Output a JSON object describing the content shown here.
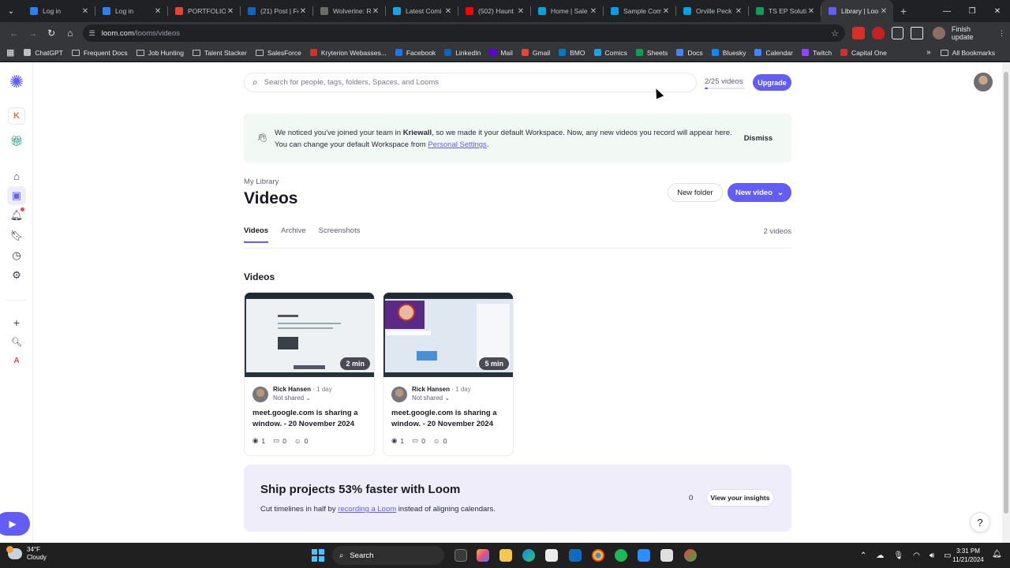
{
  "browser": {
    "tabs": [
      {
        "title": "Log in",
        "color": "#2d7ff9"
      },
      {
        "title": "Log in",
        "color": "#2d7ff9"
      },
      {
        "title": "PORTFOLIO",
        "color": "#ea4335"
      },
      {
        "title": "(21) Post | Fe",
        "color": "#0a66c2"
      },
      {
        "title": "Wolverine: R",
        "color": "#6b6b6b"
      },
      {
        "title": "Latest Comi",
        "color": "#19a4e6"
      },
      {
        "title": "(502) Haunt",
        "color": "#ff0000"
      },
      {
        "title": "Home | Sale",
        "color": "#00a1e0"
      },
      {
        "title": "Sample Com",
        "color": "#00a1e0"
      },
      {
        "title": "Orville Peck",
        "color": "#00a1e0"
      },
      {
        "title": "TS EP Soluti",
        "color": "#0f9d58"
      },
      {
        "title": "Library | Loo",
        "color": "#625df5"
      }
    ],
    "url_host": "loom.com",
    "url_path": "/looms/videos",
    "finish_update": "Finish update",
    "bookmarks": [
      {
        "label": "ChatGPT",
        "icon": "chatgpt-icon",
        "color": "#bdc1c6"
      },
      {
        "label": "Frequent Docs",
        "icon": "folder-icon",
        "color": ""
      },
      {
        "label": "Job Hunting",
        "icon": "folder-icon",
        "color": ""
      },
      {
        "label": "Talent Stacker",
        "icon": "folder-icon",
        "color": ""
      },
      {
        "label": "SalesForce",
        "icon": "folder-icon",
        "color": ""
      },
      {
        "label": "Kryterion Webasses...",
        "icon": "kryterion-icon",
        "color": "#d93025"
      },
      {
        "label": "Facebook",
        "icon": "facebook-icon",
        "color": "#1877f2"
      },
      {
        "label": "LinkedIn",
        "icon": "linkedin-icon",
        "color": "#0a66c2"
      },
      {
        "label": "Mail",
        "icon": "mail-icon",
        "color": "#6001d2"
      },
      {
        "label": "Gmail",
        "icon": "gmail-icon",
        "color": "#ea4335"
      },
      {
        "label": "BMO",
        "icon": "bmo-icon",
        "color": "#0079c1"
      },
      {
        "label": "Comics",
        "icon": "comics-icon",
        "color": "#19a4e6"
      },
      {
        "label": "Sheets",
        "icon": "sheets-icon",
        "color": "#0f9d58"
      },
      {
        "label": "Docs",
        "icon": "docs-icon",
        "color": "#4285f4"
      },
      {
        "label": "Bluesky",
        "icon": "bluesky-icon",
        "color": "#1185fe"
      },
      {
        "label": "Calendar",
        "icon": "calendar-icon",
        "color": "#4285f4"
      },
      {
        "label": "Twitch",
        "icon": "twitch-icon",
        "color": "#9146ff"
      },
      {
        "label": "Capital One",
        "icon": "capital-one-icon",
        "color": "#d03027"
      }
    ],
    "all_bookmarks": "All Bookmarks"
  },
  "loom": {
    "accent": "#625df5",
    "workspace_initial": "K",
    "member_initial": "A",
    "search_placeholder": "Search for people, tags, folders, Spaces, and Looms",
    "video_count": "2/25 videos",
    "video_quota_fraction": 0.08,
    "upgrade": "Upgrade",
    "banner": {
      "text_before": "We noticed you've joined your team in ",
      "team": "Kriewall",
      "text_after": ", so we made it your default Workspace. Now, any new videos you record will appear here. You can change your default Workspace from ",
      "link": "Personal Settings",
      "end": ".",
      "dismiss": "Dismiss"
    },
    "breadcrumb": "My Library",
    "title": "Videos",
    "new_folder": "New folder",
    "new_video": "New video",
    "tabs": [
      "Videos",
      "Archive",
      "Screenshots"
    ],
    "tab_count": "2 videos",
    "section_title": "Videos",
    "videos": [
      {
        "duration": "2 min",
        "owner": "Rick Hansen",
        "age": "1 day",
        "sharing": "Not shared",
        "title": "meet.google.com is sharing a window. - 20 November 2024",
        "views": "1",
        "comments": "0",
        "reactions": "0"
      },
      {
        "duration": "5 min",
        "owner": "Rick Hansen",
        "age": "1 day",
        "sharing": "Not shared",
        "title": "meet.google.com is sharing a window. - 20 November 2024",
        "views": "1",
        "comments": "0",
        "reactions": "0"
      }
    ],
    "promo": {
      "title": "Ship projects 53% faster with Loom",
      "text_before": "Cut timelines in half by ",
      "link": "recording a Loom",
      "text_after": " instead of aligning calendars.",
      "count": "0",
      "button": "View your insights"
    },
    "help": "?"
  },
  "taskbar": {
    "temperature": "34°F",
    "condition": "Cloudy",
    "search": "Search",
    "time": "3:31 PM",
    "date": "11/21/2024"
  }
}
